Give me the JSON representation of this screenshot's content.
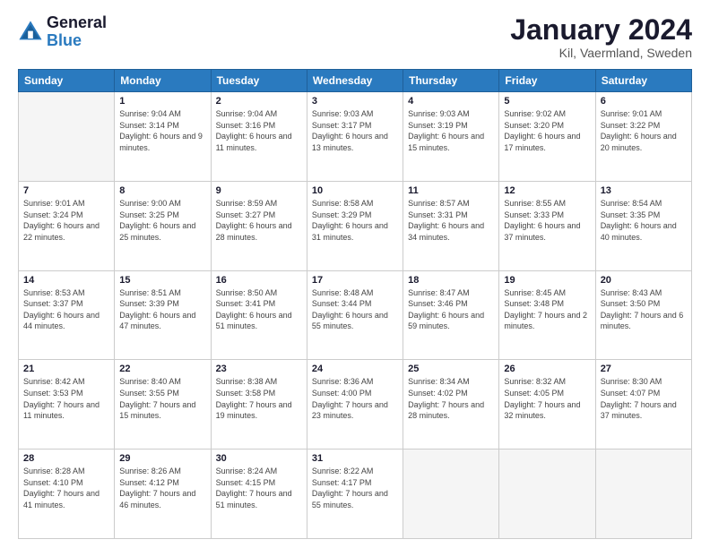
{
  "logo": {
    "text_general": "General",
    "text_blue": "Blue"
  },
  "title": "January 2024",
  "subtitle": "Kil, Vaermland, Sweden",
  "days_of_week": [
    "Sunday",
    "Monday",
    "Tuesday",
    "Wednesday",
    "Thursday",
    "Friday",
    "Saturday"
  ],
  "weeks": [
    [
      {
        "day": "",
        "empty": true
      },
      {
        "day": "1",
        "sunrise": "9:04 AM",
        "sunset": "3:14 PM",
        "daylight": "6 hours and 9 minutes."
      },
      {
        "day": "2",
        "sunrise": "9:04 AM",
        "sunset": "3:16 PM",
        "daylight": "6 hours and 11 minutes."
      },
      {
        "day": "3",
        "sunrise": "9:03 AM",
        "sunset": "3:17 PM",
        "daylight": "6 hours and 13 minutes."
      },
      {
        "day": "4",
        "sunrise": "9:03 AM",
        "sunset": "3:19 PM",
        "daylight": "6 hours and 15 minutes."
      },
      {
        "day": "5",
        "sunrise": "9:02 AM",
        "sunset": "3:20 PM",
        "daylight": "6 hours and 17 minutes."
      },
      {
        "day": "6",
        "sunrise": "9:01 AM",
        "sunset": "3:22 PM",
        "daylight": "6 hours and 20 minutes."
      }
    ],
    [
      {
        "day": "7",
        "sunrise": "9:01 AM",
        "sunset": "3:24 PM",
        "daylight": "6 hours and 22 minutes."
      },
      {
        "day": "8",
        "sunrise": "9:00 AM",
        "sunset": "3:25 PM",
        "daylight": "6 hours and 25 minutes."
      },
      {
        "day": "9",
        "sunrise": "8:59 AM",
        "sunset": "3:27 PM",
        "daylight": "6 hours and 28 minutes."
      },
      {
        "day": "10",
        "sunrise": "8:58 AM",
        "sunset": "3:29 PM",
        "daylight": "6 hours and 31 minutes."
      },
      {
        "day": "11",
        "sunrise": "8:57 AM",
        "sunset": "3:31 PM",
        "daylight": "6 hours and 34 minutes."
      },
      {
        "day": "12",
        "sunrise": "8:55 AM",
        "sunset": "3:33 PM",
        "daylight": "6 hours and 37 minutes."
      },
      {
        "day": "13",
        "sunrise": "8:54 AM",
        "sunset": "3:35 PM",
        "daylight": "6 hours and 40 minutes."
      }
    ],
    [
      {
        "day": "14",
        "sunrise": "8:53 AM",
        "sunset": "3:37 PM",
        "daylight": "6 hours and 44 minutes."
      },
      {
        "day": "15",
        "sunrise": "8:51 AM",
        "sunset": "3:39 PM",
        "daylight": "6 hours and 47 minutes."
      },
      {
        "day": "16",
        "sunrise": "8:50 AM",
        "sunset": "3:41 PM",
        "daylight": "6 hours and 51 minutes."
      },
      {
        "day": "17",
        "sunrise": "8:48 AM",
        "sunset": "3:44 PM",
        "daylight": "6 hours and 55 minutes."
      },
      {
        "day": "18",
        "sunrise": "8:47 AM",
        "sunset": "3:46 PM",
        "daylight": "6 hours and 59 minutes."
      },
      {
        "day": "19",
        "sunrise": "8:45 AM",
        "sunset": "3:48 PM",
        "daylight": "7 hours and 2 minutes."
      },
      {
        "day": "20",
        "sunrise": "8:43 AM",
        "sunset": "3:50 PM",
        "daylight": "7 hours and 6 minutes."
      }
    ],
    [
      {
        "day": "21",
        "sunrise": "8:42 AM",
        "sunset": "3:53 PM",
        "daylight": "7 hours and 11 minutes."
      },
      {
        "day": "22",
        "sunrise": "8:40 AM",
        "sunset": "3:55 PM",
        "daylight": "7 hours and 15 minutes."
      },
      {
        "day": "23",
        "sunrise": "8:38 AM",
        "sunset": "3:58 PM",
        "daylight": "7 hours and 19 minutes."
      },
      {
        "day": "24",
        "sunrise": "8:36 AM",
        "sunset": "4:00 PM",
        "daylight": "7 hours and 23 minutes."
      },
      {
        "day": "25",
        "sunrise": "8:34 AM",
        "sunset": "4:02 PM",
        "daylight": "7 hours and 28 minutes."
      },
      {
        "day": "26",
        "sunrise": "8:32 AM",
        "sunset": "4:05 PM",
        "daylight": "7 hours and 32 minutes."
      },
      {
        "day": "27",
        "sunrise": "8:30 AM",
        "sunset": "4:07 PM",
        "daylight": "7 hours and 37 minutes."
      }
    ],
    [
      {
        "day": "28",
        "sunrise": "8:28 AM",
        "sunset": "4:10 PM",
        "daylight": "7 hours and 41 minutes."
      },
      {
        "day": "29",
        "sunrise": "8:26 AM",
        "sunset": "4:12 PM",
        "daylight": "7 hours and 46 minutes."
      },
      {
        "day": "30",
        "sunrise": "8:24 AM",
        "sunset": "4:15 PM",
        "daylight": "7 hours and 51 minutes."
      },
      {
        "day": "31",
        "sunrise": "8:22 AM",
        "sunset": "4:17 PM",
        "daylight": "7 hours and 55 minutes."
      },
      {
        "day": "",
        "empty": true
      },
      {
        "day": "",
        "empty": true
      },
      {
        "day": "",
        "empty": true
      }
    ]
  ]
}
